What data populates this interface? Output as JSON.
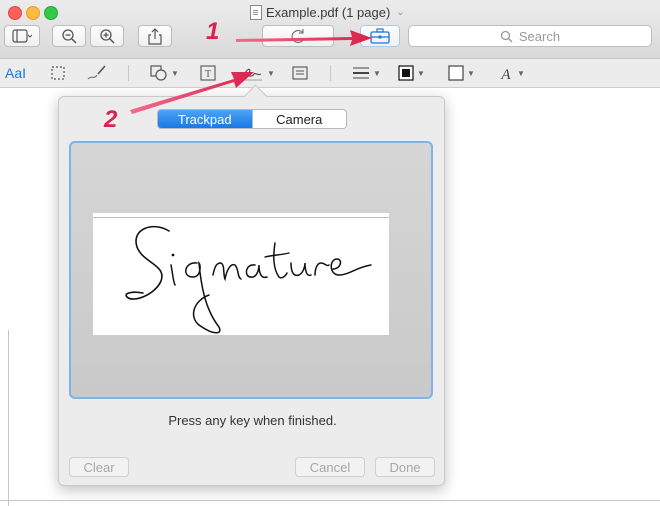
{
  "window": {
    "title": "Example.pdf (1 page)"
  },
  "toolbar": {
    "search_placeholder": "Search"
  },
  "markup": {
    "text_style_label": "AaI"
  },
  "annotations": {
    "step1": "1",
    "step2": "2"
  },
  "popover": {
    "tabs": [
      {
        "label": "Trackpad",
        "active": true
      },
      {
        "label": "Camera",
        "active": false
      }
    ],
    "signature_text": "Signature",
    "hint": "Press any key when finished.",
    "buttons": {
      "clear": "Clear",
      "cancel": "Cancel",
      "done": "Done"
    }
  },
  "colors": {
    "accent": "#1978e6",
    "arrow": "#e8336a",
    "pad_border": "#7eb4ea"
  }
}
